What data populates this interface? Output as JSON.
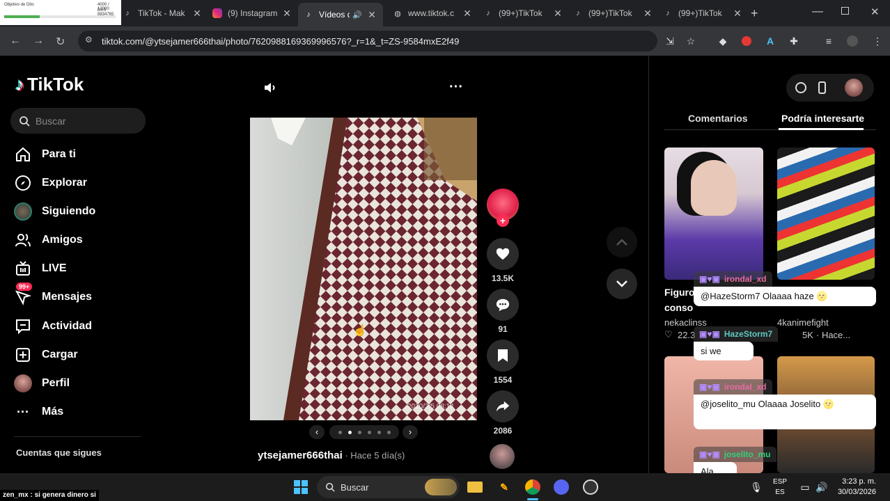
{
  "browser": {
    "tabs": [
      {
        "title": "TikTok - Mak",
        "icon": "tiktok-icon"
      },
      {
        "title": "(9) Instagram",
        "icon": "instagram-icon"
      },
      {
        "title": "Vídeos d",
        "icon": "tiktok-icon",
        "active": true
      },
      {
        "title": "www.tiktok.c",
        "icon": "globe-icon"
      },
      {
        "title": "(99+)TikTok",
        "icon": "tiktok-icon"
      },
      {
        "title": "(99+)TikTok",
        "icon": "tiktok-icon"
      },
      {
        "title": "(99+)TikTok",
        "icon": "tiktok-icon"
      }
    ],
    "url": "tiktok.com/@ytsejamer666thai/photo/7620988169369996576?_r=1&_t=ZS-9584mxE2f49",
    "preview_lines": [
      "Objetivo de Dito",
      "4000 / 12000",
      "DXS 8834765"
    ]
  },
  "sidebar": {
    "logo": "TikTok",
    "search_placeholder": "Buscar",
    "items": [
      {
        "label": "Para ti",
        "icon": "home-icon"
      },
      {
        "label": "Explorar",
        "icon": "compass-icon"
      },
      {
        "label": "Siguiendo",
        "icon": "following-avatar-icon"
      },
      {
        "label": "Amigos",
        "icon": "friends-icon"
      },
      {
        "label": "LIVE",
        "icon": "live-tv-icon"
      },
      {
        "label": "Mensajes",
        "icon": "messages-icon",
        "badge": "99+"
      },
      {
        "label": "Actividad",
        "icon": "activity-icon"
      },
      {
        "label": "Cargar",
        "icon": "upload-icon"
      },
      {
        "label": "Perfil",
        "icon": "profile-avatar-icon"
      },
      {
        "label": "Más",
        "icon": "more-dots-icon"
      }
    ],
    "following_heading": "Cuentas que sigues"
  },
  "post": {
    "timestamp_overlay": "2020/3/5  08:14",
    "author": "ytsejamer666thai",
    "age": " · Hace 5 día(s)",
    "likes": "13.5K",
    "comments": "91",
    "saves": "1554",
    "shares": "2086",
    "carousel_count": 6,
    "carousel_active": 1
  },
  "right_panel": {
    "tabs": [
      "Comentarios",
      "Podría interesarte"
    ],
    "cards": [
      {
        "title_fragment": "Figuro",
        "title_fragment2": "conso",
        "author": "nekaclinss",
        "likes": "22.3"
      },
      {
        "title_fragment": "",
        "author": "4kanimefight",
        "likes": "5K",
        "age": "· Hace..."
      }
    ]
  },
  "chat_overlay": [
    {
      "user": "irondal_xd",
      "message": "@HazeStorm7 Olaaaa haze 🌝"
    },
    {
      "user": "HazeStorm7",
      "message": "si we"
    },
    {
      "user": "irondal_xd",
      "message": "@joselito_mu Olaaaa Joselito 🌝"
    },
    {
      "user": "joselito_mu",
      "message": "Ala"
    }
  ],
  "ticker": "zen_mx : si genera dinero si",
  "taskbar": {
    "search_placeholder": "Buscar",
    "lang_top": "ESP",
    "lang_bottom": "ES",
    "time": "3:23 p. m.",
    "date": "30/03/2026"
  },
  "colors": {
    "accent": "#fe2c55",
    "chat_user": "#5ec8c0"
  }
}
